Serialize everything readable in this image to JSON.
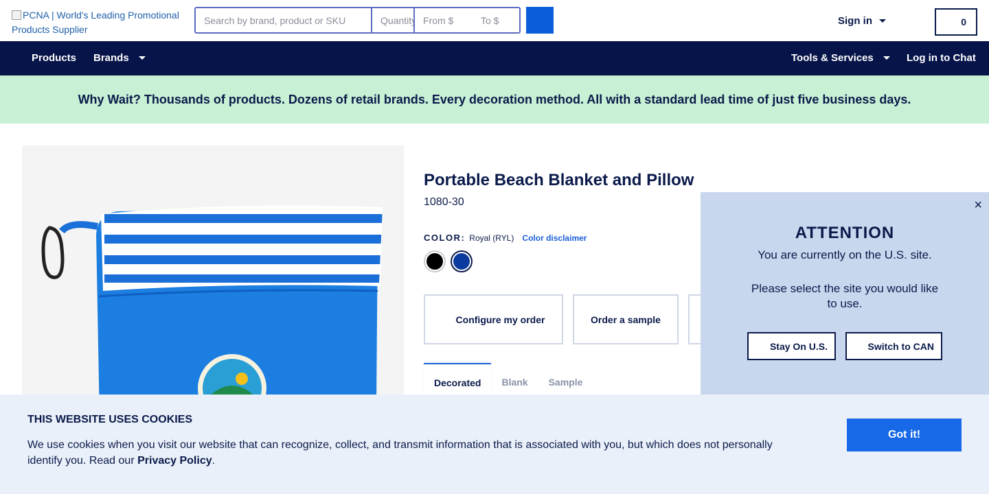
{
  "header": {
    "logo_alt": "PCNA | World's Leading Promotional Products Supplier",
    "search_placeholder": "Search by brand, product or SKU",
    "qty_placeholder": "Quantity",
    "from_placeholder": "From $",
    "to_placeholder": "To $",
    "sign_in": "Sign in",
    "cart_count": "0"
  },
  "nav": {
    "products": "Products",
    "brands": "Brands",
    "tools": "Tools & Services",
    "chat": "Log in to Chat"
  },
  "banner": {
    "text": "Why Wait? Thousands of products. Dozens of retail brands. Every decoration method. All with a standard lead time of just five business days."
  },
  "product": {
    "title": "Portable Beach Blanket and Pillow",
    "sku": "1080-30",
    "color_label": "COLOR:",
    "color_value": "Royal (RYL)",
    "color_disclaimer": "Color disclaimer",
    "swatches": [
      {
        "name": "Black",
        "color": "#000000"
      },
      {
        "name": "Royal",
        "color": "#0c3a9e"
      }
    ],
    "configure": "Configure my order",
    "sample": "Order a sample",
    "tabs": [
      "Decorated",
      "Blank",
      "Sample"
    ]
  },
  "attention": {
    "title": "ATTENTION",
    "line1": "You are currently on the U.S. site.",
    "line2": "Please select the site you would like to use.",
    "stay": "Stay On U.S.",
    "switch": "Switch to CAN",
    "close": "×"
  },
  "cookie": {
    "title": "THIS WEBSITE USES COOKIES",
    "body": "We use cookies when you visit our website that can recognize, collect, and transmit information that is associated with you, but which does not personally identify you. Read our ",
    "link": "Privacy Policy",
    "period": ".",
    "button": "Got it!"
  },
  "colors": {
    "navy": "#07144a",
    "accent_blue": "#1769e8",
    "banner_green": "#c8f0d4"
  }
}
